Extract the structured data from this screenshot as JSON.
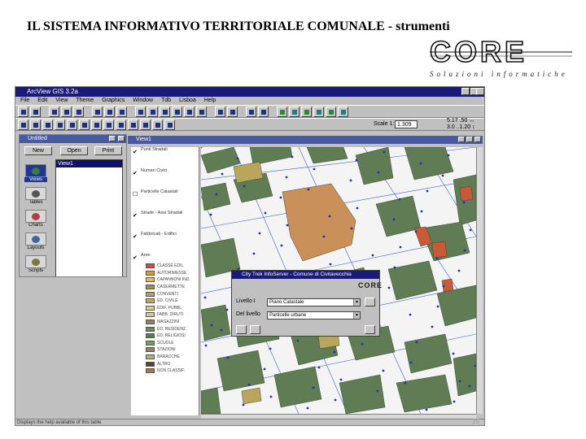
{
  "slide": {
    "title": "IL SISTEMA INFORMATIVO TERRITORIALE COMUNALE - strumenti",
    "logo_text": "CORE",
    "logo_tagline": "Soluzioni informatiche",
    "page_number": "25"
  },
  "app": {
    "title": "ArcView GIS 3.2a",
    "menu": [
      "File",
      "Edit",
      "View",
      "Theme",
      "Graphics",
      "Window",
      "Tdb",
      "Lisboa",
      "Help"
    ],
    "scale_label": "Scale 1:",
    "scale_value": "1.309",
    "coords": [
      "5.17 .50 ↔",
      "3.0 ..1.20 ↕"
    ],
    "status_text": "Displays the help available of this table"
  },
  "project": {
    "title": "Untitled",
    "buttons": [
      "New",
      "Open",
      "Print"
    ],
    "docs": [
      "Views",
      "Tables",
      "Charts",
      "Layouts",
      "Scripts"
    ],
    "selected_item": "View1"
  },
  "view": {
    "title": "View1",
    "themes": [
      {
        "name": "Punti Stradali",
        "checked": true
      },
      {
        "name": "Numeri Civici",
        "checked": true
      },
      {
        "name": "Particelle Catastali",
        "checked": false
      },
      {
        "name": "Strade - Assi Stradali",
        "checked": true
      },
      {
        "name": "Fabbricati - Edifici",
        "checked": true
      },
      {
        "name": "Aree",
        "checked": true
      }
    ],
    "legend": [
      {
        "label": "CLASSE EDIL.",
        "color": "#c8503a"
      },
      {
        "label": "AUTORIMESSE",
        "color": "#d89a3a"
      },
      {
        "label": "CAPANNONI IND.",
        "color": "#e0c060"
      },
      {
        "label": "CASERMETTE",
        "color": "#a09050"
      },
      {
        "label": "CONVENTI",
        "color": "#b0a070"
      },
      {
        "label": "ED. CIVILE",
        "color": "#c0a870"
      },
      {
        "label": "EDIF. PUBBL.",
        "color": "#e0c890"
      },
      {
        "label": "FABB. DIRUTI",
        "color": "#d8c8a0"
      },
      {
        "label": "MAGAZZINI",
        "color": "#90806a"
      },
      {
        "label": "ED. RESIDENZ.",
        "color": "#6a8a5a"
      },
      {
        "label": "ED. RELIGIOSI",
        "color": "#5a7a50"
      },
      {
        "label": "SCUOLE",
        "color": "#7a9a6a"
      },
      {
        "label": "STAZIONI",
        "color": "#908060"
      },
      {
        "label": "BARACCHE",
        "color": "#b0b080"
      },
      {
        "label": "ALTRO",
        "color": "#504830"
      },
      {
        "label": "NON CLASSIF.",
        "color": "#a07a50"
      }
    ]
  },
  "dialog": {
    "title": "City Trek InfoServer - Comune di Civitavecchia",
    "logo_text": "CORE",
    "row1_label": "Livello I",
    "row1_value": "Piano Catastale",
    "row2_label": "Del livello",
    "row2_value": "Particelle urbane"
  },
  "colors": {
    "building_green": "#5f7c55",
    "building_orange": "#c9905a",
    "building_yellow": "#b9a55c",
    "building_red": "#c85a3a",
    "street_blue": "#3a5fd0",
    "point_blue": "#2030b0"
  }
}
